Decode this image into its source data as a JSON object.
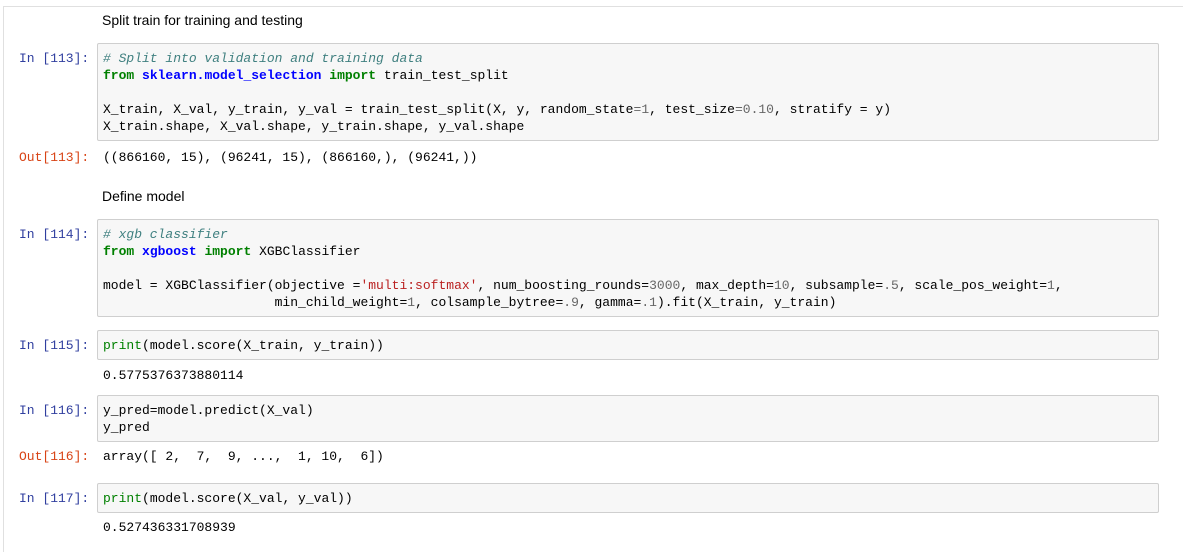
{
  "cells": {
    "md1": "Split train for training and testing",
    "c113": {
      "prompt": "In [113]:",
      "line1_comment": "# Split into validation and training data",
      "line2_kw_from": "from",
      "line2_mod": "sklearn.model_selection",
      "line2_kw_import": "import",
      "line2_name": " train_test_split",
      "line4_a": "X_train, X_val, y_train, y_val = train_test_split(X, y, random_state",
      "line4_eq1": "=",
      "line4_n1": "1",
      "line4_b": ", test_size",
      "line4_eq2": "=",
      "line4_n2": "0.10",
      "line4_c": ", stratify = y)",
      "line5": "X_train.shape, X_val.shape, y_train.shape, y_val.shape",
      "out_prompt": "Out[113]:",
      "output": "((866160, 15), (96241, 15), (866160,), (96241,))"
    },
    "md2": "Define model",
    "c114": {
      "prompt": "In [114]:",
      "line1_comment": "# xgb classifier",
      "line2_kw_from": "from",
      "line2_mod": "xgboost",
      "line2_kw_import": "import",
      "line2_name": " XGBClassifier",
      "line4_a": "model = XGBClassifier(objective =",
      "line4_str": "'multi:softmax'",
      "line4_b": ", num_boosting_rounds=",
      "line4_n1": "3000",
      "line4_c": ", max_depth=",
      "line4_n2": "10",
      "line4_d": ", subsample=",
      "line4_n3": ".5",
      "line4_e": ", scale_pos_weight=",
      "line4_n4": "1",
      "line4_f": ",",
      "line5_a": "                      min_child_weight=",
      "line5_n1": "1",
      "line5_b": ", colsample_bytree=",
      "line5_n2": ".9",
      "line5_c": ", gamma=",
      "line5_n3": ".1",
      "line5_d": ").fit(X_train, y_train)"
    },
    "c115": {
      "prompt": "In [115]:",
      "fn": "print",
      "rest": "(model.score(X_train, y_train))",
      "output": "0.5775376373880114"
    },
    "c116": {
      "prompt": "In [116]:",
      "line1": "y_pred=model.predict(X_val)",
      "line2": "y_pred",
      "out_prompt": "Out[116]:",
      "output": "array([ 2,  7,  9, ...,  1, 10,  6])"
    },
    "c117": {
      "prompt": "In [117]:",
      "fn": "print",
      "rest": "(model.score(X_val, y_val))",
      "output": "0.527436331708939"
    }
  }
}
